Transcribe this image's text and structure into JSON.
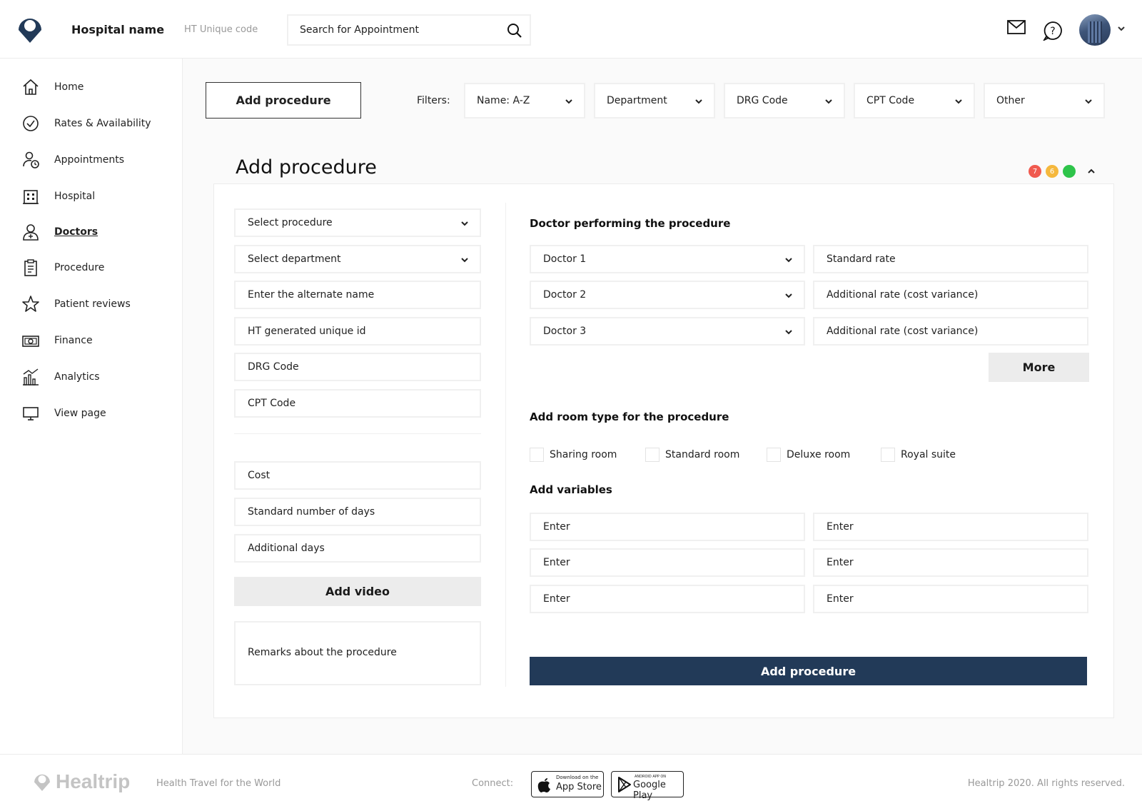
{
  "header": {
    "hospital_name": "Hospital name",
    "unique_code": "HT Unique code",
    "search_placeholder": "Search for Appointment"
  },
  "sidebar": {
    "items": [
      {
        "label": "Home",
        "icon": "home-icon"
      },
      {
        "label": "Rates & Availability",
        "icon": "check-circle-icon"
      },
      {
        "label": "Appointments",
        "icon": "user-clock-icon"
      },
      {
        "label": "Hospital",
        "icon": "building-icon"
      },
      {
        "label": "Doctors",
        "icon": "doctor-icon",
        "active": true
      },
      {
        "label": "Procedure",
        "icon": "clipboard-icon"
      },
      {
        "label": "Patient reviews",
        "icon": "star-icon"
      },
      {
        "label": "Finance",
        "icon": "cash-icon"
      },
      {
        "label": "Analytics",
        "icon": "analytics-icon"
      },
      {
        "label": "View page",
        "icon": "monitor-icon"
      }
    ]
  },
  "toolbar": {
    "add_button": "Add procedure",
    "filters_label": "Filters:",
    "filters": [
      "Name: A-Z",
      "Department",
      "DRG Code",
      "CPT Code",
      "Other"
    ]
  },
  "panel": {
    "title": "Add procedure",
    "status_dots": [
      {
        "count": "7",
        "color": "#f05a4f"
      },
      {
        "count": "6",
        "color": "#f5b83d"
      },
      {
        "count": "",
        "color": "#2ec44a"
      }
    ],
    "left_fields": [
      "Select procedure",
      "Select department",
      "Enter the alternate name",
      "HT generated unique id",
      "DRG Code",
      "CPT Code"
    ],
    "cost_fields": [
      "Cost",
      "Standard number of days",
      "Additional days"
    ],
    "add_video": "Add video",
    "remarks": "Remarks about the procedure",
    "doctor_section_title": "Doctor performing the procedure",
    "doctors": [
      {
        "name": "Doctor 1",
        "rate": "Standard rate"
      },
      {
        "name": "Doctor 2",
        "rate": "Additional rate (cost variance)"
      },
      {
        "name": "Doctor 3",
        "rate": "Additional rate (cost variance)"
      }
    ],
    "more_button": "More",
    "room_section_title": "Add room type for the procedure",
    "rooms": [
      "Sharing room",
      "Standard room",
      "Deluxe room",
      "Royal suite"
    ],
    "variables_title": "Add variables",
    "variables": [
      [
        "Enter",
        "Enter"
      ],
      [
        "Enter",
        "Enter"
      ],
      [
        "Enter",
        "Enter"
      ]
    ],
    "submit_button": "Add procedure"
  },
  "footer": {
    "brand": "Healtrip",
    "tagline": "Health Travel for the World",
    "connect": "Connect:",
    "app_store_small": "Download on the",
    "app_store": "App Store",
    "google_play_small": "ANDROID APP ON",
    "google_play": "Google Play",
    "copyright": "Healtrip 2020. All rights reserved."
  }
}
